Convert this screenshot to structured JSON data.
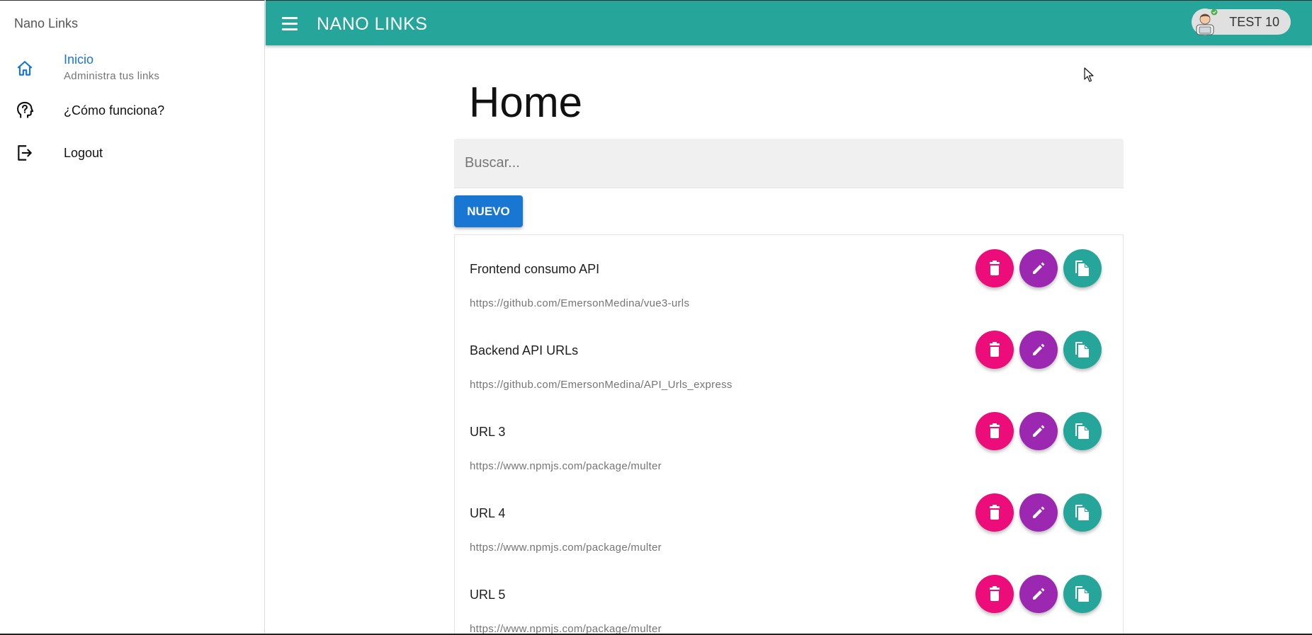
{
  "drawer": {
    "title": "Nano Links",
    "items": [
      {
        "label": "Inicio",
        "caption": "Administra tus links",
        "icon": "home-icon",
        "active": true
      },
      {
        "label": "¿Cómo funciona?",
        "icon": "help-head-icon"
      },
      {
        "label": "Logout",
        "icon": "logout-icon"
      }
    ]
  },
  "header": {
    "title": "NANO LINKS",
    "user": "TEST 10"
  },
  "main": {
    "title": "Home",
    "search_placeholder": "Buscar...",
    "new_label": "NUEVO",
    "links": [
      {
        "title": "Frontend consumo API",
        "url": "https://github.com/EmersonMedina/vue3-urls"
      },
      {
        "title": "Backend API URLs",
        "url": "https://github.com/EmersonMedina/API_Urls_express"
      },
      {
        "title": "URL 3",
        "url": "https://www.npmjs.com/package/multer"
      },
      {
        "title": "URL 4",
        "url": "https://www.npmjs.com/package/multer"
      },
      {
        "title": "URL 5",
        "url": "https://www.npmjs.com/package/multer"
      }
    ]
  },
  "colors": {
    "header": "#26a69a",
    "primary": "#1976d2",
    "delete": "#ec0c7a",
    "edit": "#9c27b0",
    "copy": "#26a69a"
  }
}
